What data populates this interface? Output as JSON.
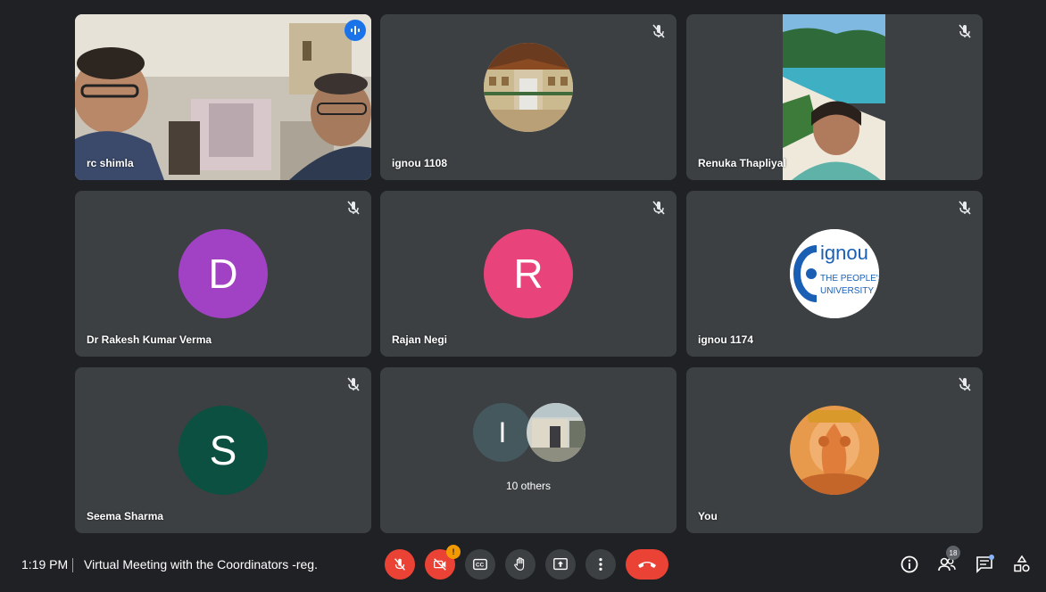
{
  "tiles": [
    {
      "name": "rc shimla",
      "active": true
    },
    {
      "name": "ignou 1108"
    },
    {
      "name": "Renuka Thapliyal"
    },
    {
      "name": "Dr Rakesh Kumar Verma",
      "initial": "D",
      "color": "#a142c4"
    },
    {
      "name": "Rajan Negi",
      "initial": "R",
      "color": "#e8437a"
    },
    {
      "name": "ignou 1174",
      "logo": {
        "line1": "ignou",
        "line2": "THE PEOPLE'S",
        "line3": "UNIVERSITY"
      }
    },
    {
      "name": "Seema Sharma",
      "initial": "S",
      "color": "#0b5040"
    },
    {
      "initial": "I",
      "color": "#44585e",
      "others_label": "10 others"
    },
    {
      "name": "You"
    }
  ],
  "bar": {
    "time": "1:19 PM",
    "title": "Virtual Meeting with the Coordinators -reg.",
    "camera_notification": "!",
    "participants_count": "18",
    "buttons": [
      "mic-off",
      "camera-off",
      "captions",
      "raise-hand",
      "present",
      "more-options",
      "end-call"
    ],
    "right_icons": [
      "info",
      "people",
      "chat",
      "activities"
    ]
  }
}
